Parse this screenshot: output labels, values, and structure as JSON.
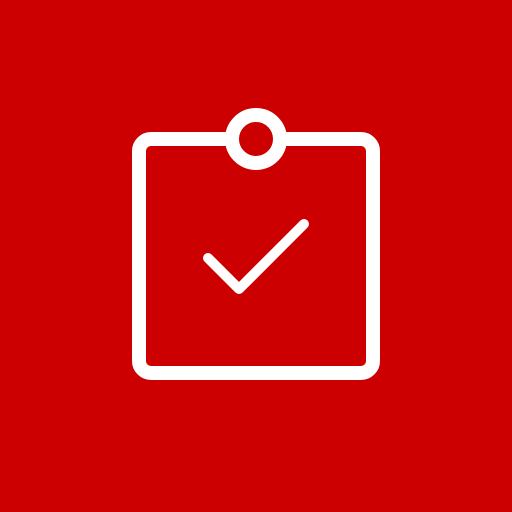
{
  "app_icon": {
    "icon": "clipboard-check-icon",
    "background_color": "#cc0000",
    "foreground_color": "#ffffff"
  }
}
